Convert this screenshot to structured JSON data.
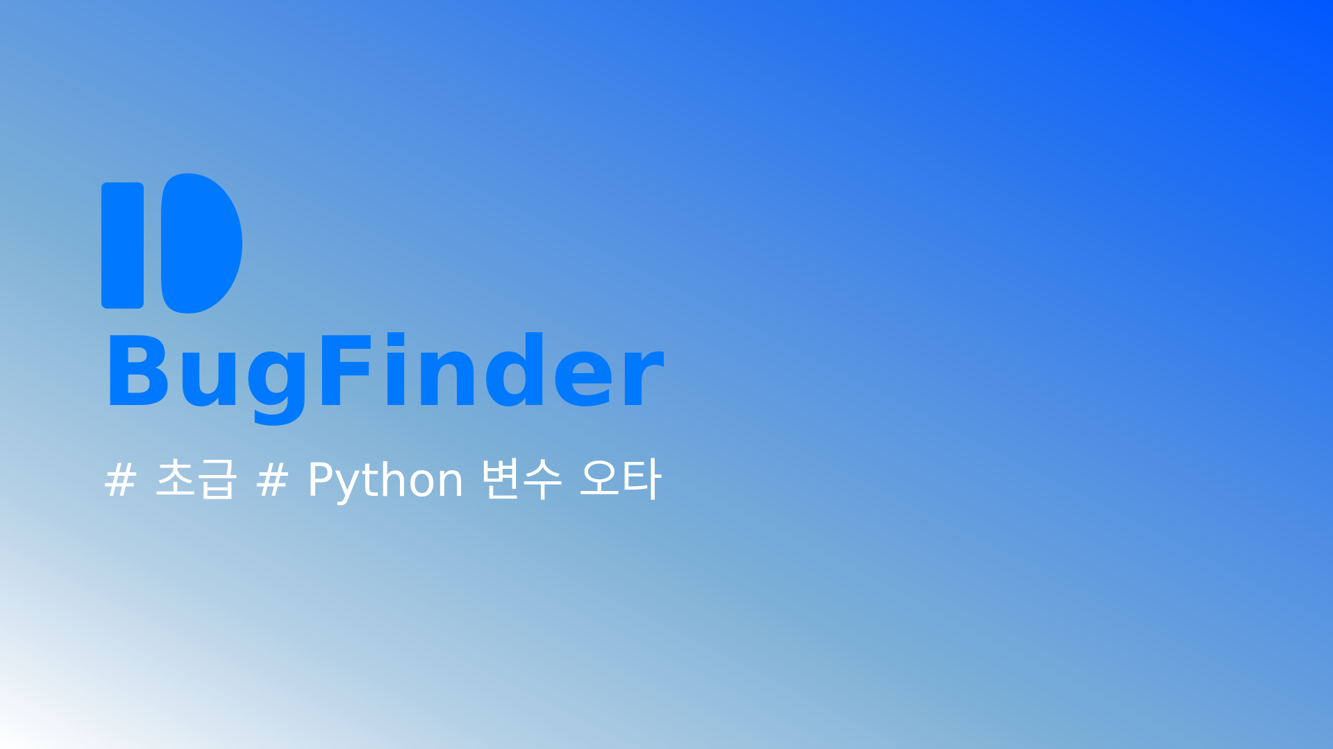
{
  "brand": {
    "name": "BugFinder",
    "color": "#0179fe",
    "logo_icon": "bugfinder-logo-icon"
  },
  "tags": {
    "text": "# 초급 # Python  변수 오타",
    "color": "#ffffff"
  },
  "background": {
    "gradient_colors": [
      "#0057ff",
      "#5693e2",
      "#7db0d6",
      "#ffffff"
    ]
  }
}
